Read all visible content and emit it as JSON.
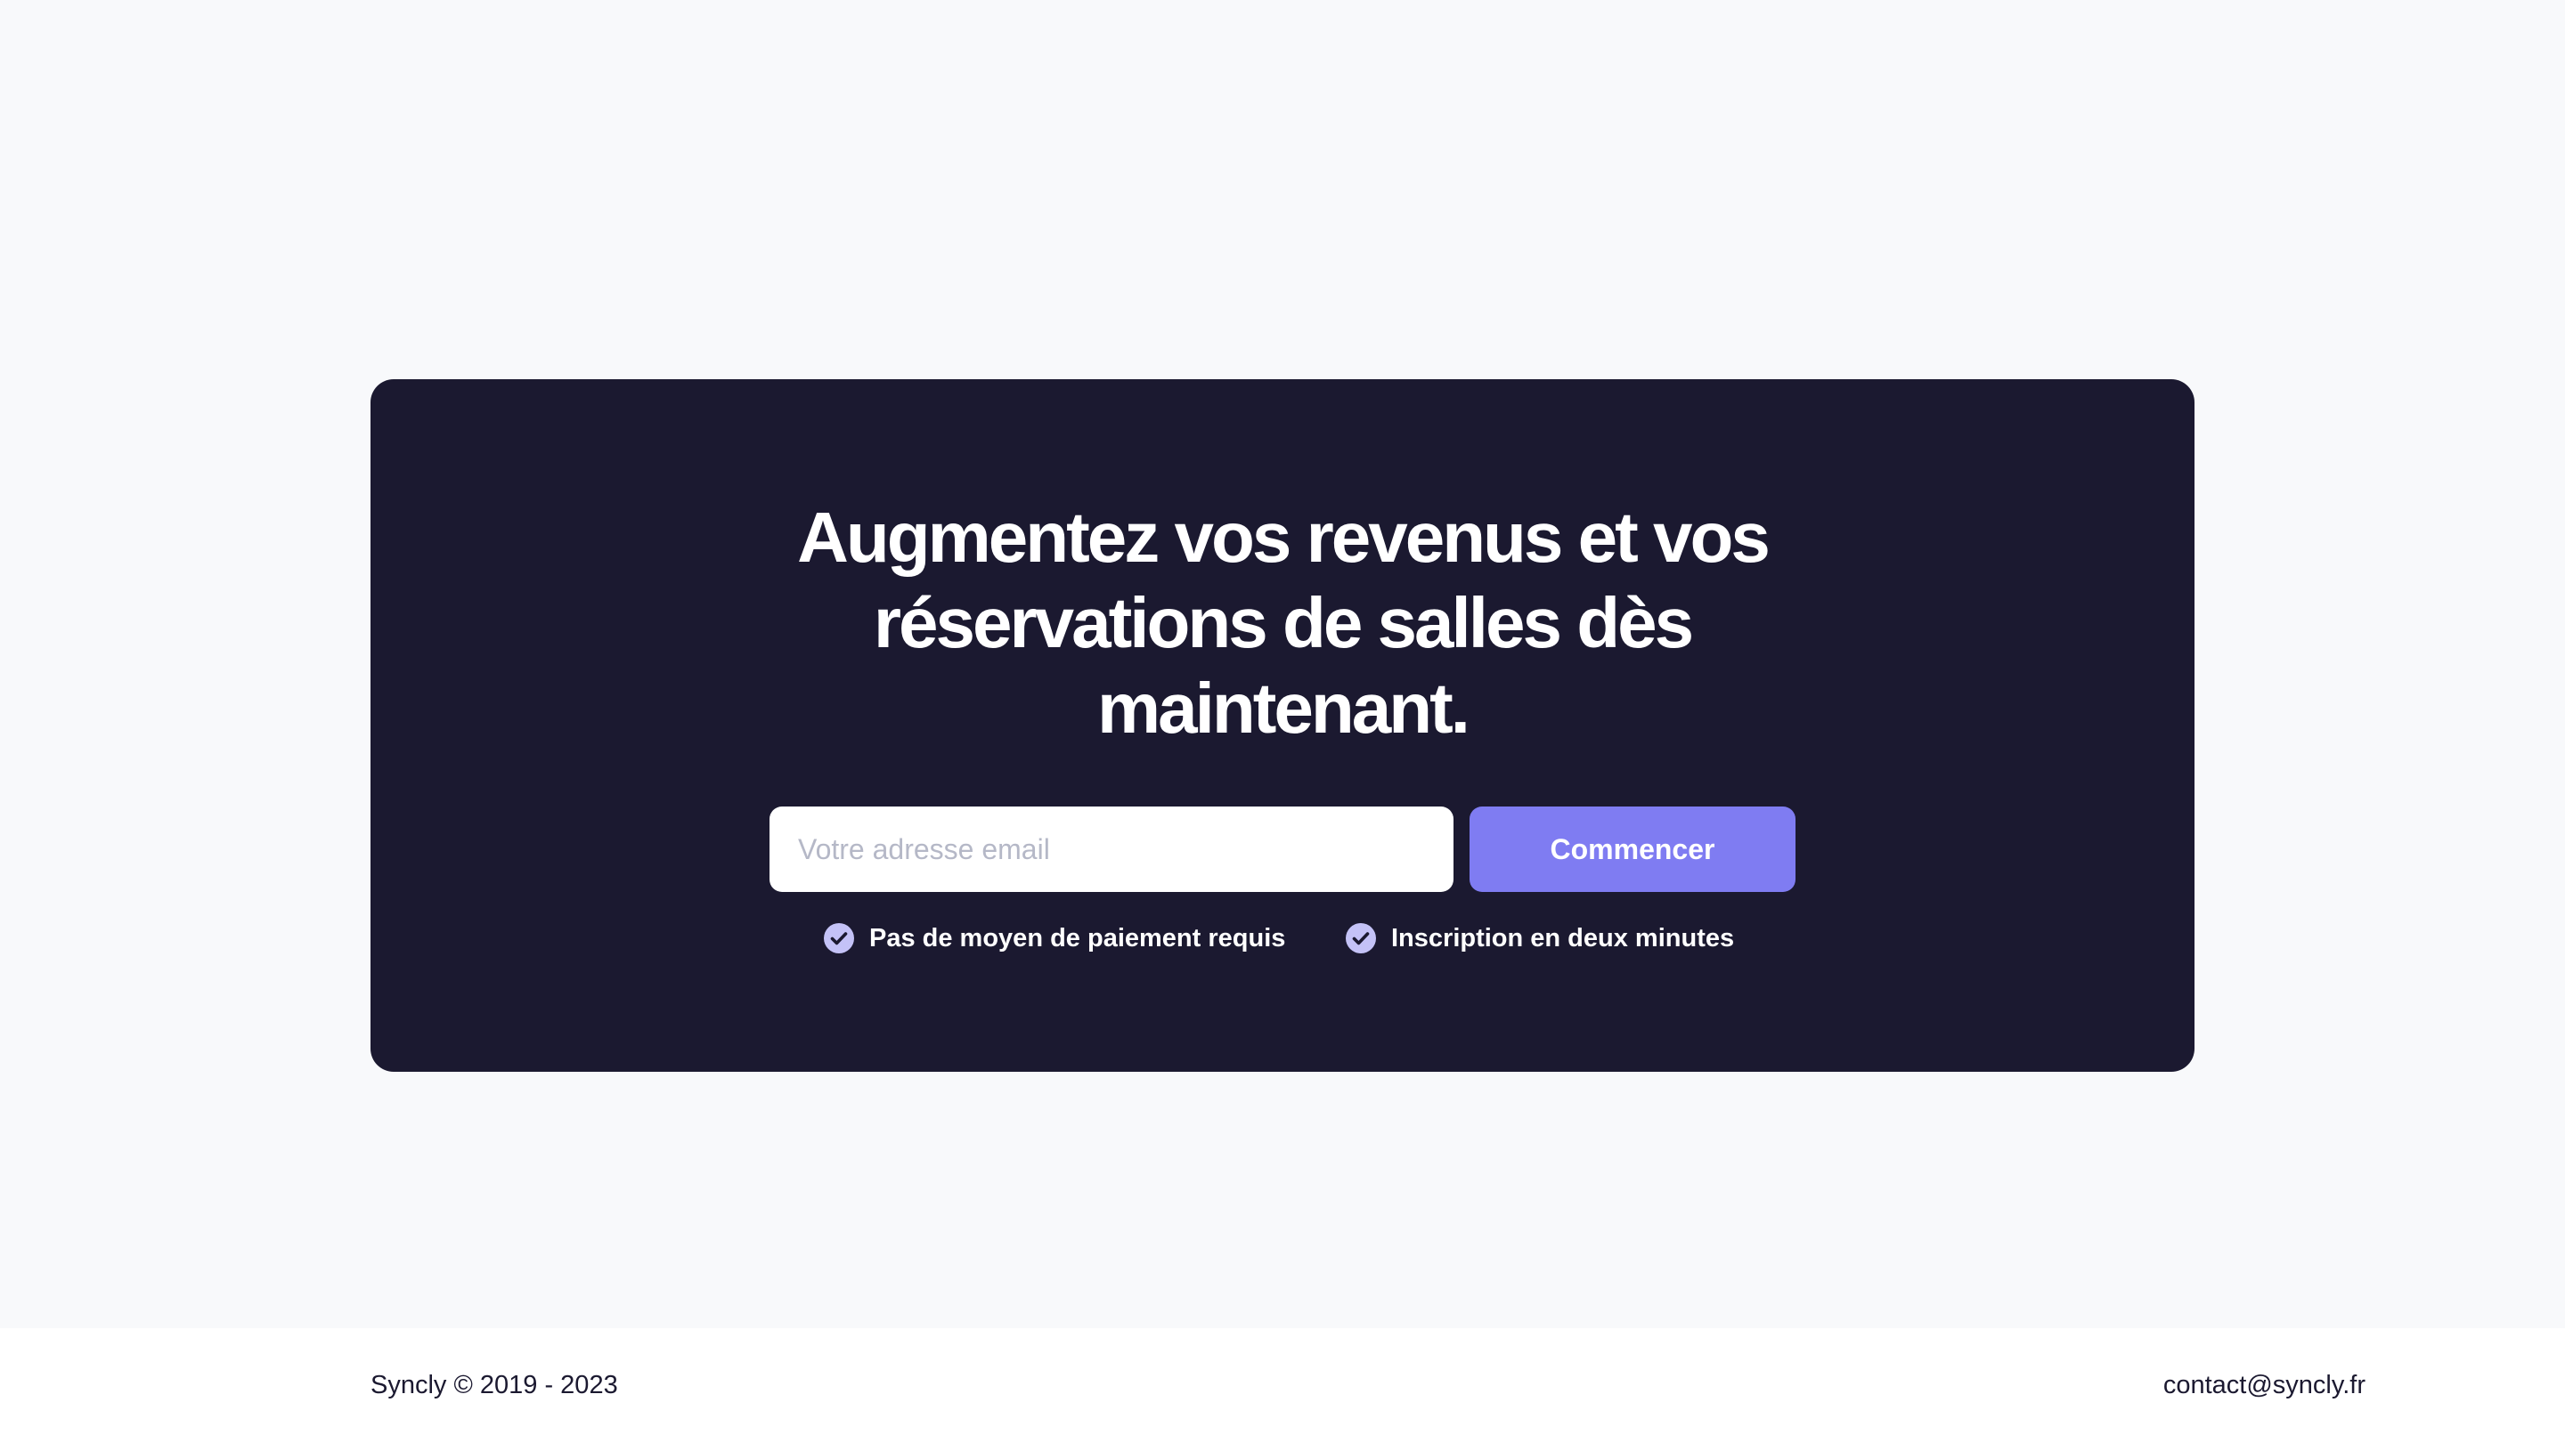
{
  "cta": {
    "title_lines": [
      "Augmentez vos revenus et vos",
      "réservations de salles dès",
      "maintenant."
    ],
    "email_placeholder": "Votre adresse email",
    "email_value": "",
    "button_label": "Commencer",
    "perks": [
      {
        "icon": "check-circle-icon",
        "label": "Pas de moyen de paiement requis"
      },
      {
        "icon": "check-circle-icon",
        "label": "Inscription en deux minutes"
      }
    ]
  },
  "footer": {
    "copyright": "Syncly © 2019 - 2023",
    "contact": "contact@syncly.fr"
  },
  "colors": {
    "page_background": "#f8f9fb",
    "card_background": "#1b1930",
    "accent": "#7f7cf2",
    "check_fill": "#c4c2f7"
  }
}
